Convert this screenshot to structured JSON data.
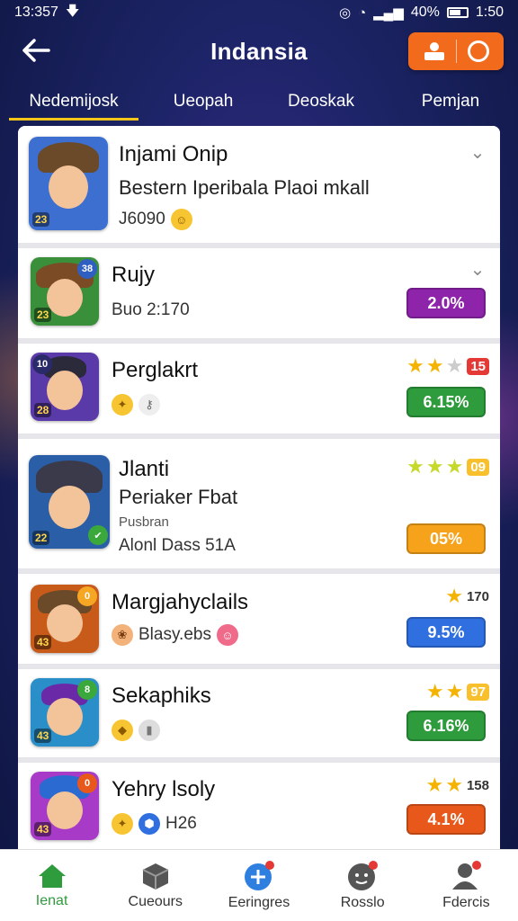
{
  "status_bar": {
    "time": "13:357",
    "battery_text": "40%",
    "clock_right": "1:50"
  },
  "header": {
    "title": "Indansia"
  },
  "tabs": [
    {
      "label": "Nedemijosk"
    },
    {
      "label": "Ueopah"
    },
    {
      "label": "Deoskak"
    },
    {
      "label": "Pemjan"
    }
  ],
  "rows": [
    {
      "title": "Injami Onip",
      "subtitle": "Bestern Iperibala Plaoi mkall",
      "meta": "J6090",
      "level": "23",
      "colors": {
        "bg": "#3d6fd1",
        "hat": "#6b4a2a"
      }
    },
    {
      "title": "Rujy",
      "meta": "Buo 2:170",
      "level": "23",
      "corner": "38",
      "value": "2.0%",
      "value_color": "#8e24aa",
      "colors": {
        "bg": "#3a8f3a",
        "hat": "#7a4b25"
      }
    },
    {
      "title": "Perglakrt",
      "level": "28",
      "corner": "10",
      "star_count": "15",
      "value": "6.15%",
      "value_color": "#2e9b3c",
      "colors": {
        "bg": "#5a3aa8",
        "hat": "#2a2a3a"
      }
    },
    {
      "title": "Jlanti",
      "subtitle": "Periaker Fbat",
      "small": "Pusbran",
      "meta": "Alonl Dass 51A",
      "level": "22",
      "star_count": "09",
      "value": "05%",
      "value_color": "#f6a21a",
      "colors": {
        "bg": "#2a5fa8",
        "hat": "#3a3a4a"
      }
    },
    {
      "title": "Margjahyclails",
      "meta": "Blasy.ebs",
      "level": "43",
      "corner": "0",
      "star_count": "170",
      "value": "9.5%",
      "value_color": "#2f6fe0",
      "colors": {
        "bg": "#c85a1a",
        "hat": "#6b4a2a"
      }
    },
    {
      "title": "Sekaphiks",
      "level": "43",
      "corner": "8",
      "star_count": "97",
      "value": "6.16%",
      "value_color": "#2e9b3c",
      "colors": {
        "bg": "#2a8fc8",
        "hat": "#6a2aa8"
      }
    },
    {
      "title": "Yehry lsoly",
      "meta": "H26",
      "level": "43",
      "corner": "0",
      "star_count": "158",
      "value": "4.1%",
      "value_color": "#e8581a",
      "colors": {
        "bg": "#a83ac8",
        "hat": "#2a6ad1"
      }
    }
  ],
  "bottom_nav": [
    {
      "label": "Ienat",
      "icon": "home-icon"
    },
    {
      "label": "Cueours",
      "icon": "cube-icon"
    },
    {
      "label": "Eeringres",
      "icon": "plus-badge-icon"
    },
    {
      "label": "Rosslo",
      "icon": "chat-face-icon"
    },
    {
      "label": "Fdercis",
      "icon": "person-icon"
    }
  ],
  "accent_colors": {
    "header_action": "#f26a1b",
    "tab_indicator": "#f5c518",
    "nav_active": "#2e9b3c"
  }
}
